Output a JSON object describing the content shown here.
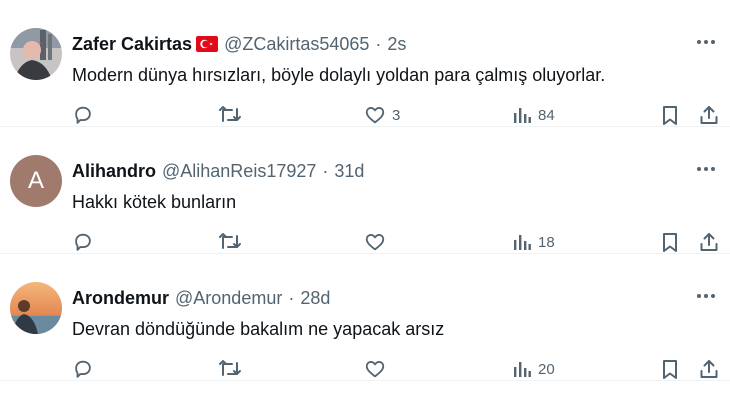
{
  "tweets": [
    {
      "name": "Zafer Cakirtas",
      "handle": "@ZCakirtas54065",
      "separator": "·",
      "time": "2s",
      "text": "Modern dünya hırsızları, böyle dolaylı yoldan para çalmış oluyorlar.",
      "avatar": "photo",
      "has_flag": true,
      "flag_icon": "turkey-flag-icon",
      "stats": {
        "replies": "",
        "retweets": "",
        "likes": "3",
        "views": "84"
      }
    },
    {
      "name": "Alihandro",
      "handle": "@AlihanReis17927",
      "separator": "·",
      "time": "31d",
      "text": "Hakkı kötek bunların",
      "avatar": "letter",
      "avatar_letter": "A",
      "avatar_color": "#a07a6c",
      "stats": {
        "replies": "",
        "retweets": "",
        "likes": "",
        "views": "18"
      }
    },
    {
      "name": "Arondemur",
      "handle": "@Arondemur",
      "separator": "·",
      "time": "28d",
      "text": "Devran döndüğünde bakalım ne yapacak arsız",
      "avatar": "photo",
      "stats": {
        "replies": "",
        "retweets": "",
        "likes": "",
        "views": "20"
      }
    }
  ],
  "icons": {
    "reply": "reply-icon",
    "retweet": "retweet-icon",
    "like": "heart-icon",
    "views": "views-icon",
    "bookmark": "bookmark-icon",
    "share": "share-icon",
    "more": "more-icon"
  },
  "colors": {
    "text": "#0f1419",
    "secondary": "#536471",
    "divider": "#eff3f4"
  }
}
